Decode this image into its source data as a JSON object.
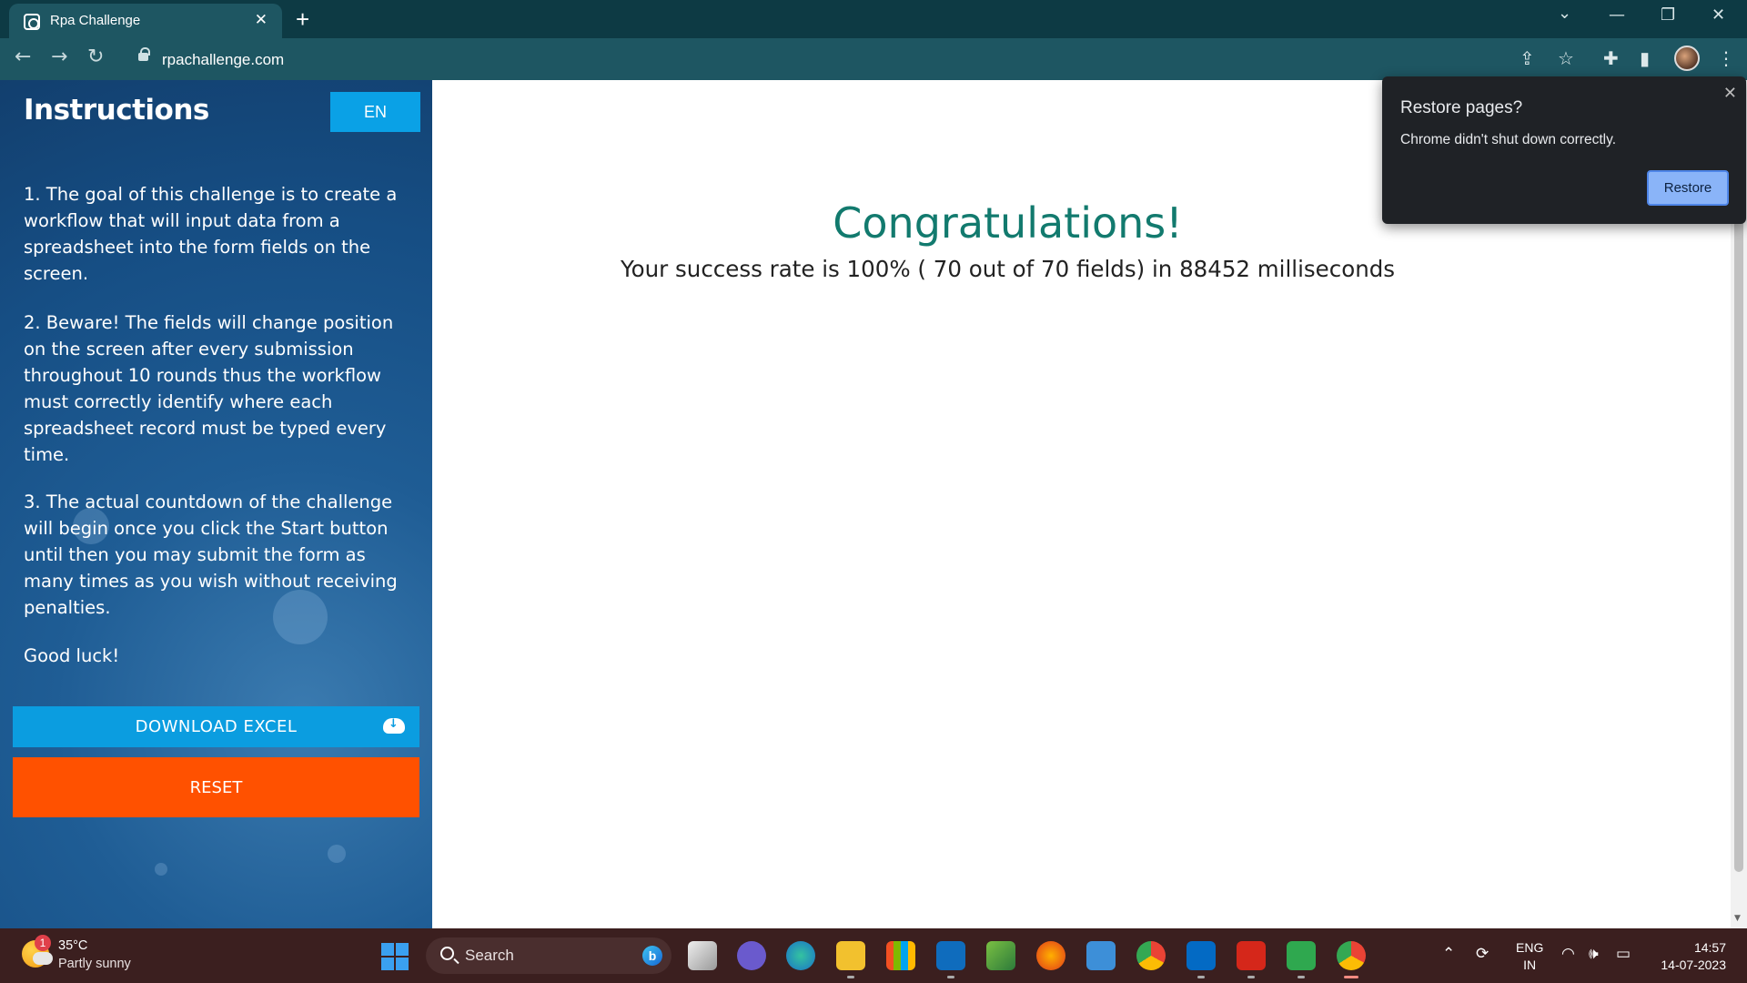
{
  "browser": {
    "tab_title": "Rpa Challenge",
    "tab_close": "✕",
    "new_tab": "+",
    "url": "rpachallenge.com"
  },
  "sidebar": {
    "title": "Instructions",
    "lang_button": "EN",
    "instructions": [
      "1. The goal of this challenge is to create a workflow that will input data from a spreadsheet into the form fields on the screen.",
      "2. Beware! The fields will change position on the screen after every submission throughout 10 rounds thus the workflow must correctly identify where each spreadsheet record must be typed every time.",
      "3. The actual countdown of the challenge will begin once you click the Start button until then you may submit the form as many times as you wish without receiving penalties.",
      "Good luck!"
    ],
    "download_button": "DOWNLOAD EXCEL",
    "reset_button": "RESET"
  },
  "result": {
    "heading": "Congratulations!",
    "message": "Your success rate is 100% ( 70 out of 70 fields) in 88452 milliseconds"
  },
  "popup": {
    "title": "Restore pages?",
    "message": "Chrome didn't shut down correctly.",
    "close": "✕",
    "restore_button": "Restore"
  },
  "taskbar": {
    "weather_badge": "1",
    "temperature": "35°C",
    "condition": "Partly sunny",
    "search_label": "Search",
    "bing_label": "b",
    "language_line1": "ENG",
    "language_line2": "IN",
    "time": "14:57",
    "date": "14-07-2023",
    "apps": [
      "task-view",
      "teams-chat",
      "edge",
      "file-explorer",
      "microsoft-store",
      "outlook",
      "photos",
      "firefox",
      "notepad",
      "chrome",
      "sharepoint",
      "acrobat",
      "media-player",
      "chrome-profile"
    ]
  },
  "colors": {
    "sidebar_accent": "#0aa1e6",
    "reset": "#ff5100",
    "heading": "#127a6e",
    "chrome_frame": "#1e5662"
  }
}
